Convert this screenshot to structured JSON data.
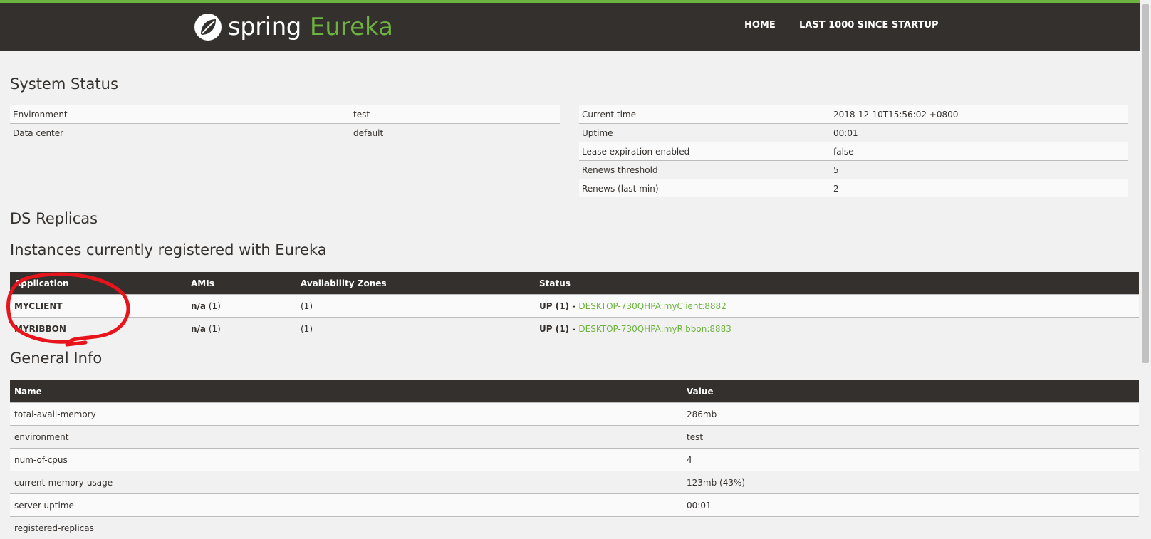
{
  "header": {
    "logo_spring": "spring",
    "logo_eureka": "Eureka",
    "nav": {
      "home": "HOME",
      "last": "LAST 1000 SINCE STARTUP"
    },
    "colors": {
      "bar": "#34302d",
      "accent": "#6db33f"
    }
  },
  "system_status": {
    "title": "System Status",
    "left": [
      {
        "label": "Environment",
        "value": "test"
      },
      {
        "label": "Data center",
        "value": "default"
      }
    ],
    "right": [
      {
        "label": "Current time",
        "value": "2018-12-10T15:56:02 +0800"
      },
      {
        "label": "Uptime",
        "value": "00:01"
      },
      {
        "label": "Lease expiration enabled",
        "value": "false"
      },
      {
        "label": "Renews threshold",
        "value": "5"
      },
      {
        "label": "Renews (last min)",
        "value": "2"
      }
    ]
  },
  "ds_replicas": {
    "title": "DS Replicas"
  },
  "instances": {
    "title": "Instances currently registered with Eureka",
    "headers": {
      "application": "Application",
      "amis": "AMIs",
      "zones": "Availability Zones",
      "status": "Status"
    },
    "rows": [
      {
        "application": "MYCLIENT",
        "ami_na": "n/a",
        "ami_count": "(1)",
        "zones": "(1)",
        "status_up": "UP (1) - ",
        "status_link": "DESKTOP-730QHPA:myClient:8882"
      },
      {
        "application": "MYRIBBON",
        "ami_na": "n/a",
        "ami_count": "(1)",
        "zones": "(1)",
        "status_up": "UP (1) - ",
        "status_link": "DESKTOP-730QHPA:myRibbon:8883"
      }
    ]
  },
  "general_info": {
    "title": "General Info",
    "headers": {
      "name": "Name",
      "value": "Value"
    },
    "rows": [
      {
        "name": "total-avail-memory",
        "value": "286mb"
      },
      {
        "name": "environment",
        "value": "test"
      },
      {
        "name": "num-of-cpus",
        "value": "4"
      },
      {
        "name": "current-memory-usage",
        "value": "123mb (43%)"
      },
      {
        "name": "server-uptime",
        "value": "00:01"
      },
      {
        "name": "registered-replicas",
        "value": ""
      }
    ]
  }
}
